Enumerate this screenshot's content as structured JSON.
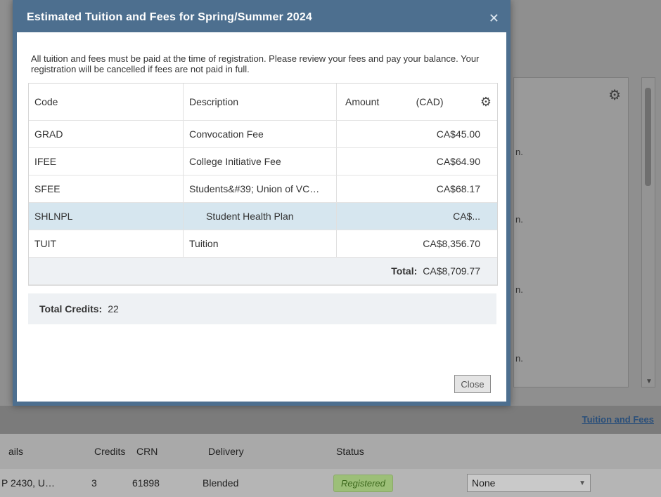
{
  "modal": {
    "title": "Estimated Tuition and Fees for Spring/Summer 2024",
    "notice": "All tuition and fees must be paid at the time of registration. Please review your fees and pay your balance. Your registration will be cancelled if fees are not paid in full.",
    "columns": {
      "code": "Code",
      "description": "Description",
      "amount": "Amount",
      "currency": "(CAD)"
    },
    "rows": [
      {
        "code": "GRAD",
        "description": "Convocation Fee",
        "amount": "CA$45.00"
      },
      {
        "code": "IFEE",
        "description": "College Initiative Fee",
        "amount": "CA$64.90"
      },
      {
        "code": "SFEE",
        "description": "Students&#39; Union of VC…",
        "amount": "CA$68.17"
      },
      {
        "code": "SHLNPL",
        "description": "Student Health Plan",
        "amount": "CA$..."
      },
      {
        "code": "TUIT",
        "description": "Tuition",
        "amount": "CA$8,356.70"
      }
    ],
    "total_label": "Total:",
    "total_value": "CA$8,709.77",
    "credits_label": "Total Credits:",
    "credits_value": "22",
    "close_label": "Close"
  },
  "background": {
    "link": "Tuition and Fees",
    "grid": {
      "headers": [
        "ails",
        "Credits",
        "CRN",
        "Delivery",
        "Status"
      ],
      "row": {
        "details": "P 2430, U…",
        "credits": "3",
        "crn": "61898",
        "delivery": "Blended",
        "status": "Registered",
        "action": "None"
      }
    },
    "frag_n": "n."
  }
}
